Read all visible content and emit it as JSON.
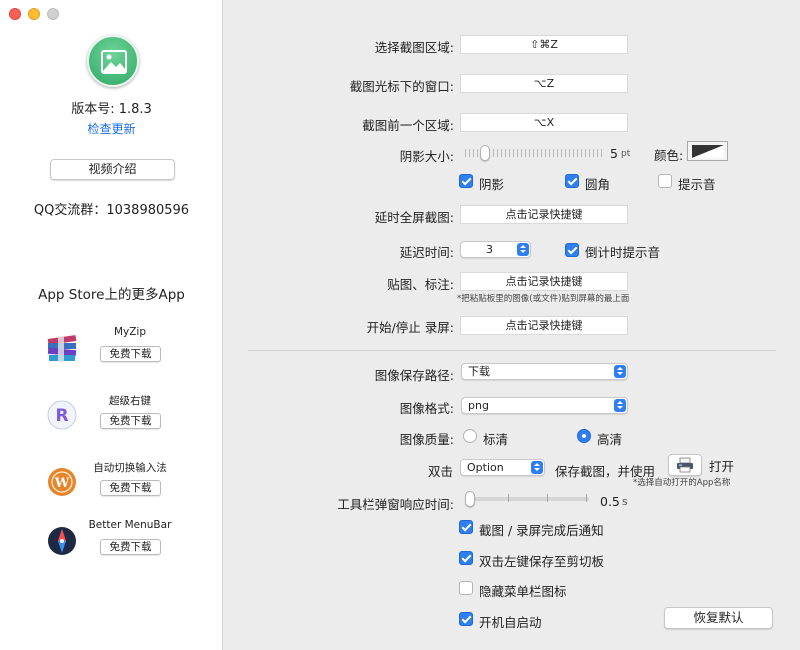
{
  "sidebar": {
    "version": "版本号: 1.8.3",
    "check_update": "检查更新",
    "video_intro": "视频介绍",
    "qq_group": "QQ交流群：1038980596",
    "more_apps_title": "App Store上的更多App",
    "apps": [
      {
        "name": "MyZip",
        "download": "免费下载",
        "icon": "books-stack-icon"
      },
      {
        "name": "超级右键",
        "download": "免费下载",
        "icon": "letter-r-icon"
      },
      {
        "name": "自动切换输入法",
        "download": "免费下载",
        "icon": "letter-w-icon"
      },
      {
        "name": "Better MenuBar",
        "download": "免费下载",
        "icon": "compass-icon"
      }
    ]
  },
  "main": {
    "select_area": {
      "label": "选择截图区域:",
      "shortcut": "⇧⌘Z"
    },
    "window_under_cursor": {
      "label": "截图光标下的窗口:",
      "shortcut": "⌥Z"
    },
    "previous_area": {
      "label": "截图前一个区域:",
      "shortcut": "⌥X"
    },
    "shadow_size": {
      "label": "阴影大小:",
      "value": "5",
      "unit": "pt",
      "level": 0.03
    },
    "color": {
      "label": "颜色:",
      "swatch_dark": "#333333",
      "swatch_light": "#ffffff"
    },
    "options": {
      "shadow": {
        "label": "阴影",
        "checked": true
      },
      "rounded": {
        "label": "圆角",
        "checked": true
      },
      "sound": {
        "label": "提示音",
        "checked": false
      }
    },
    "delayed_fullscreen": {
      "label": "延时全屏截图:",
      "placeholder": "点击记录快捷键"
    },
    "delay_time": {
      "label": "延迟时间:",
      "value": "3",
      "countdown_label": "倒计时提示音",
      "countdown_checked": true
    },
    "pin_annotate": {
      "label": "贴图、标注:",
      "placeholder": "点击记录快捷键",
      "note": "*把粘贴板里的图像(或文件)贴到屏幕的最上面"
    },
    "record": {
      "label": "开始/停止 录屏:",
      "placeholder": "点击记录快捷键"
    },
    "save_path": {
      "label": "图像保存路径:",
      "value": "下载"
    },
    "format": {
      "label": "图像格式:",
      "value": "png"
    },
    "quality": {
      "label": "图像质量:",
      "standard": "标清",
      "high": "高清",
      "selected": "high"
    },
    "double_click": {
      "label": "双击",
      "modifier": "Option",
      "action": "保存截图，并使用",
      "open": "打开",
      "note": "*选择自动打开的App名称"
    },
    "toolbar_delay": {
      "label": "工具栏弹窗响应时间:",
      "value": "0.5",
      "unit": "s",
      "level": 0.0
    },
    "notify_done": {
      "label": "截图 / 录屏完成后通知",
      "checked": true
    },
    "double_left_clipboard": {
      "label": "双击左键保存至剪切板",
      "checked": true
    },
    "hide_menubar": {
      "label": "隐藏菜单栏图标",
      "checked": false
    },
    "launch_at_login": {
      "label": "开机自启动",
      "checked": true
    },
    "restore_defaults": "恢复默认"
  }
}
